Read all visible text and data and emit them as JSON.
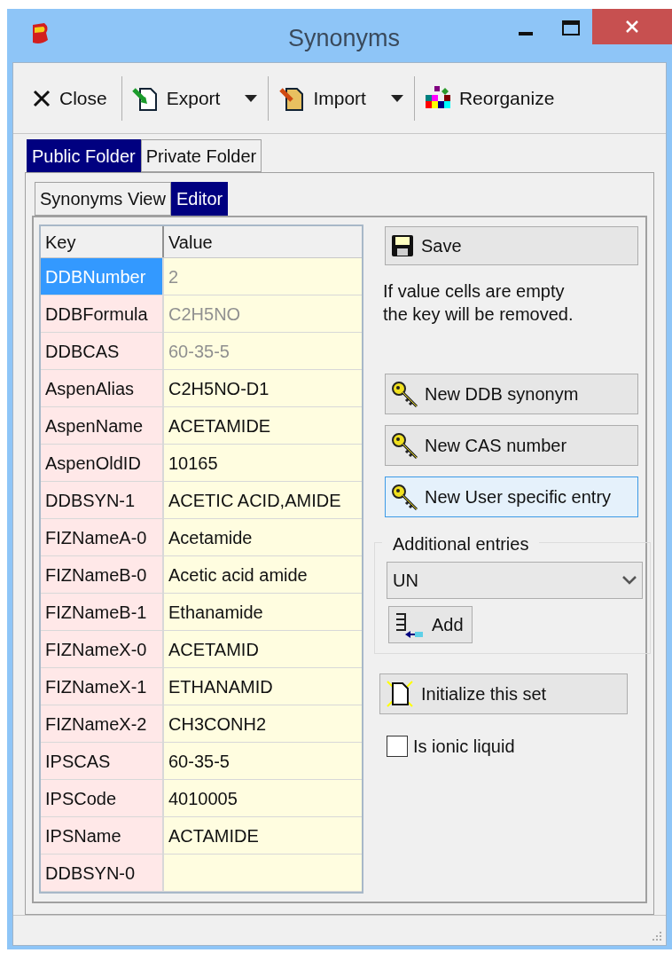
{
  "window": {
    "title": "Synonyms"
  },
  "toolbar": [
    {
      "label": "Close",
      "kind": "button"
    },
    {
      "label": "Export",
      "kind": "split"
    },
    {
      "label": "Import",
      "kind": "split"
    },
    {
      "label": "Reorganize",
      "kind": "button"
    }
  ],
  "folder_tabs": [
    {
      "label": "Public Folder",
      "selected": true
    },
    {
      "label": "Private Folder",
      "selected": false
    }
  ],
  "view_tabs": [
    {
      "label": "Synonyms View",
      "selected": false
    },
    {
      "label": "Editor",
      "selected": true
    }
  ],
  "grid": {
    "columns": [
      "Key",
      "Value"
    ],
    "rows": [
      {
        "key": "DDBNumber",
        "value": "2",
        "selected": true,
        "readonly": true
      },
      {
        "key": "DDBFormula",
        "value": "C2H5NO",
        "selected": false,
        "readonly": true
      },
      {
        "key": "DDBCAS",
        "value": "60-35-5",
        "selected": false,
        "readonly": true
      },
      {
        "key": "AspenAlias",
        "value": "C2H5NO-D1",
        "selected": false,
        "readonly": false
      },
      {
        "key": "AspenName",
        "value": "ACETAMIDE",
        "selected": false,
        "readonly": false
      },
      {
        "key": "AspenOldID",
        "value": "10165",
        "selected": false,
        "readonly": false
      },
      {
        "key": "DDBSYN-1",
        "value": "ACETIC ACID,AMIDE",
        "selected": false,
        "readonly": false
      },
      {
        "key": "FIZNameA-0",
        "value": "Acetamide",
        "selected": false,
        "readonly": false
      },
      {
        "key": "FIZNameB-0",
        "value": "Acetic acid amide",
        "selected": false,
        "readonly": false
      },
      {
        "key": "FIZNameB-1",
        "value": "Ethanamide",
        "selected": false,
        "readonly": false
      },
      {
        "key": "FIZNameX-0",
        "value": "ACETAMID",
        "selected": false,
        "readonly": false
      },
      {
        "key": "FIZNameX-1",
        "value": "ETHANAMID",
        "selected": false,
        "readonly": false
      },
      {
        "key": "FIZNameX-2",
        "value": "CH3CONH2",
        "selected": false,
        "readonly": false
      },
      {
        "key": "IPSCAS",
        "value": "60-35-5",
        "selected": false,
        "readonly": false
      },
      {
        "key": "IPSCode",
        "value": "4010005",
        "selected": false,
        "readonly": false
      },
      {
        "key": "IPSName",
        "value": "ACTAMIDE",
        "selected": false,
        "readonly": false
      },
      {
        "key": "DDBSYN-0",
        "selected": false
      }
    ]
  },
  "save_button": "Save",
  "note": "If value cells are empty\nthe key will be removed.",
  "entry_buttons": [
    {
      "label": "New DDB synonym",
      "hot": false
    },
    {
      "label": "New CAS number",
      "hot": false
    },
    {
      "label": "New User specific entry",
      "hot": true
    }
  ],
  "additional_entries": {
    "title": "Additional entries",
    "combo_value": "UN",
    "add_button": "Add"
  },
  "initialize_button": "Initialize this set",
  "ionic_liquid": {
    "label": "Is ionic liquid",
    "checked": false
  }
}
